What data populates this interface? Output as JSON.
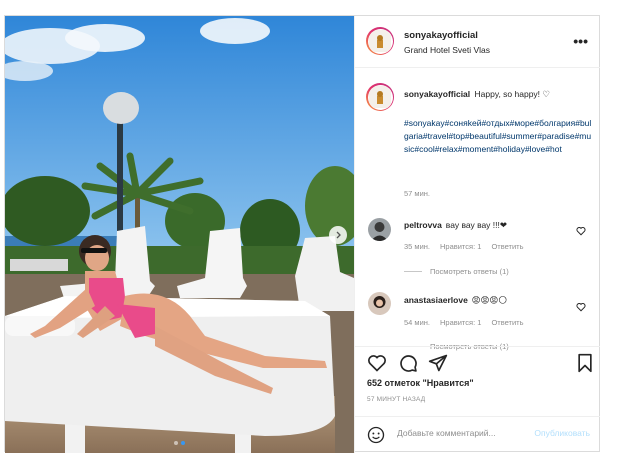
{
  "post": {
    "username": "sonyakayofficial",
    "location": "Grand Hotel Sveti Vlas",
    "more_icon": "more-horizontal-icon",
    "photo_dots": 2,
    "photo_active_dot": 2
  },
  "caption": {
    "username": "sonyakayofficial",
    "text": "Happy, so happy! ♡",
    "hashtags": "#sonyakay#соняkей#отдых#море#болгария#bulgaria#travel#top#beautiful#summer#paradise#music#cool#relax#moment#holiday#love#hot",
    "time": "57 мин."
  },
  "comments": [
    {
      "username": "peltrovva",
      "text": "вау вау вау !!!❤",
      "time": "35 мин.",
      "likes": "Нравится: 1",
      "reply": "Ответить",
      "replies": "Посмотреть ответы (1)"
    },
    {
      "username": "anastasiaerlove",
      "text": "😡😡😡🌕",
      "time": "54 мин.",
      "likes": "Нравится: 1",
      "reply": "Ответить",
      "replies": "Посмотреть ответы (1)"
    }
  ],
  "actions": {
    "like_icon": "heart-icon",
    "comment_icon": "comment-icon",
    "share_icon": "paper-plane-icon",
    "save_icon": "bookmark-icon"
  },
  "likes_text": "652 отметок \"Нравится\"",
  "time_ago": "57 МИНУТ НАЗАД",
  "add_comment": {
    "placeholder": "Добавьте комментарий...",
    "publish": "Опубликовать"
  },
  "colors": {
    "link_hashtag": "#00376b",
    "muted": "#8e8e8e",
    "publish_disabled": "#b2dffc"
  }
}
